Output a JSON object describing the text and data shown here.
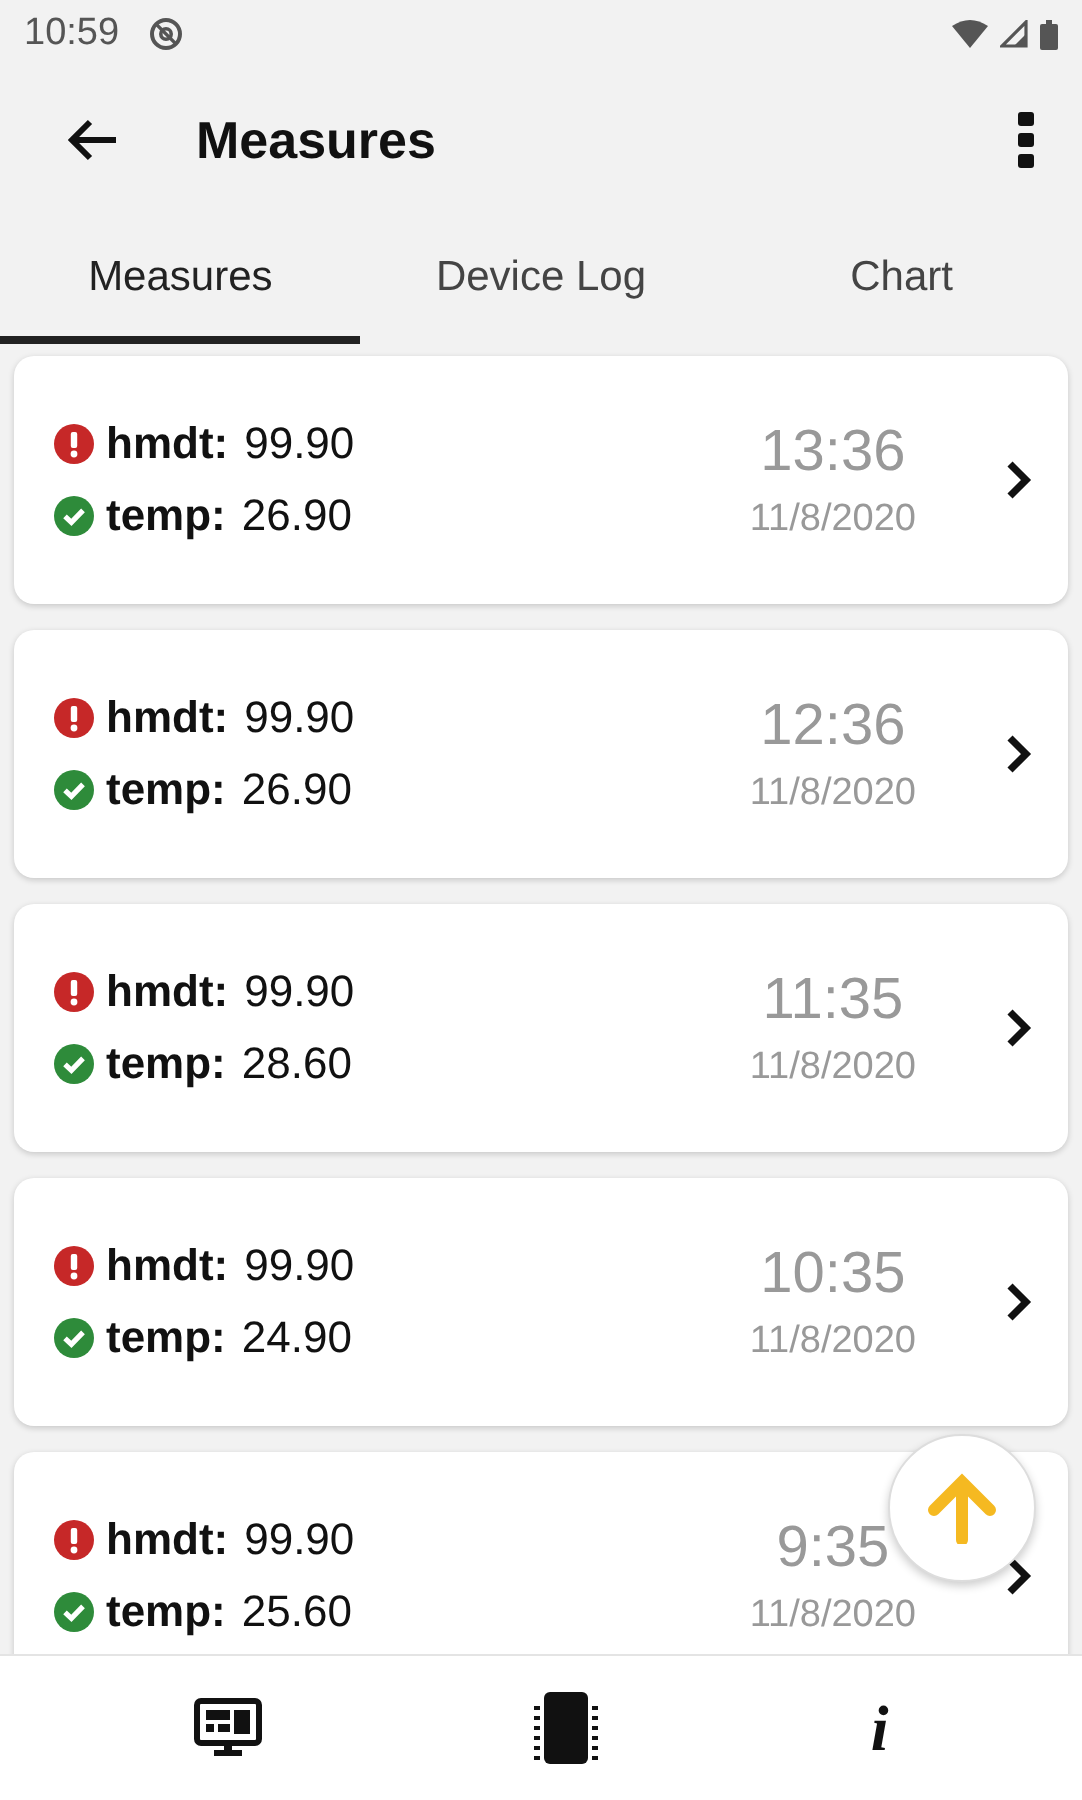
{
  "status_bar": {
    "time": "10:59"
  },
  "app_bar": {
    "title": "Measures"
  },
  "tabs": [
    {
      "label": "Measures",
      "selected": true
    },
    {
      "label": "Device Log",
      "selected": false
    },
    {
      "label": "Chart",
      "selected": false
    }
  ],
  "measures": [
    {
      "readings": [
        {
          "kind": "alert",
          "label": "hmdt:",
          "value": "99.90"
        },
        {
          "kind": "ok",
          "label": "temp:",
          "value": "26.90"
        }
      ],
      "time": "13:36",
      "date": "11/8/2020"
    },
    {
      "readings": [
        {
          "kind": "alert",
          "label": "hmdt:",
          "value": "99.90"
        },
        {
          "kind": "ok",
          "label": "temp:",
          "value": "26.90"
        }
      ],
      "time": "12:36",
      "date": "11/8/2020"
    },
    {
      "readings": [
        {
          "kind": "alert",
          "label": "hmdt:",
          "value": "99.90"
        },
        {
          "kind": "ok",
          "label": "temp:",
          "value": "28.60"
        }
      ],
      "time": "11:35",
      "date": "11/8/2020"
    },
    {
      "readings": [
        {
          "kind": "alert",
          "label": "hmdt:",
          "value": "99.90"
        },
        {
          "kind": "ok",
          "label": "temp:",
          "value": "24.90"
        }
      ],
      "time": "10:35",
      "date": "11/8/2020"
    },
    {
      "readings": [
        {
          "kind": "alert",
          "label": "hmdt:",
          "value": "99.90"
        },
        {
          "kind": "ok",
          "label": "temp:",
          "value": "25.60"
        }
      ],
      "time": "9:35",
      "date": "11/8/2020"
    }
  ],
  "bottom_nav": [
    {
      "kind": "monitor"
    },
    {
      "kind": "chip"
    },
    {
      "kind": "info",
      "glyph": "i"
    }
  ]
}
